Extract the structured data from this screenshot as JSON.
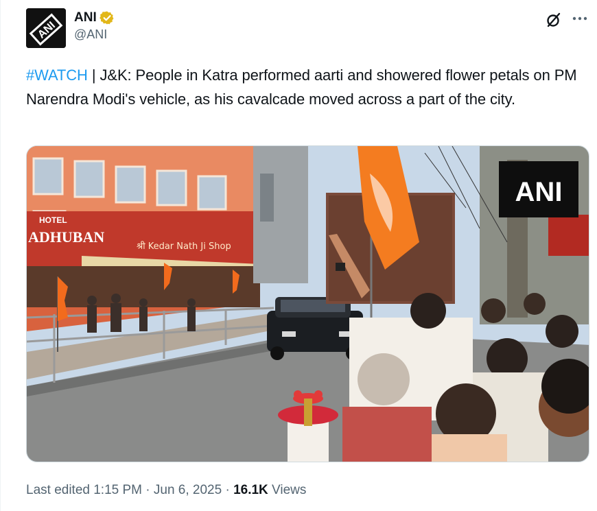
{
  "author": {
    "display_name": "ANI",
    "handle": "@ANI",
    "avatar_text": "ANI"
  },
  "tweet": {
    "hashtag": "#WATCH",
    "body": " | J&K: People in Katra performed aarti and showered flower petals on PM Narendra Modi's vehicle, as his cavalcade moved across a part of the city."
  },
  "media": {
    "watermark": "ANI",
    "scene_text": {
      "hotel": "HOTEL",
      "hotel_name": "ADHUBAN",
      "shop_sign": "श्री Kedar Nath Ji Shop"
    }
  },
  "meta": {
    "edited": "Last edited 1:15 PM · Jun 6, 2025 · ",
    "views_count": "16.1K",
    "views_label": " Views"
  },
  "colors": {
    "accent": "#1d9bf0",
    "verified": "#e2b719",
    "muted": "#536471"
  },
  "icons": {
    "verified": "verified-badge-icon",
    "grok": "grok-icon",
    "more": "more-icon"
  }
}
